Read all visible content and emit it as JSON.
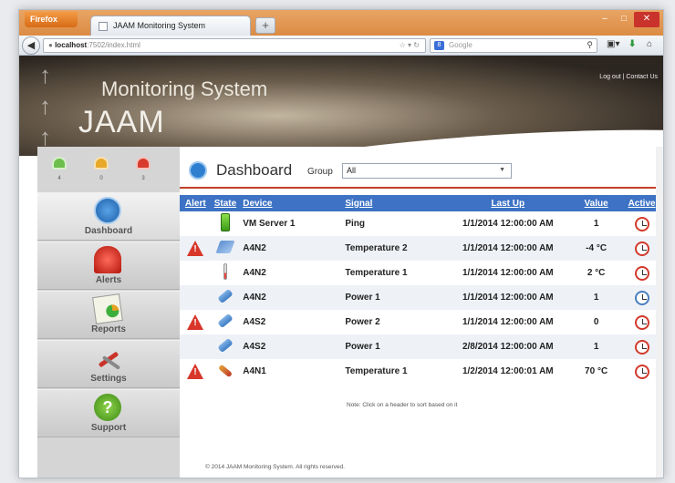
{
  "browser": {
    "menu_label": "Firefox",
    "tab_title": "JAAM Monitoring System",
    "newtab_label": "+",
    "url_host": "localhost",
    "url_path": ":7502/index.html",
    "search_placeholder": "Google",
    "search_engine_glyph": "8"
  },
  "header": {
    "title_top": "Monitoring System",
    "title_brand": "JAAM",
    "link_logout": "Log out",
    "link_separator": " | ",
    "link_contact": "Contact Us"
  },
  "gauges": [
    {
      "color": "#6dbf4b",
      "count": "4"
    },
    {
      "color": "#e8a92b",
      "count": "0"
    },
    {
      "color": "#d83a2b",
      "count": "3"
    }
  ],
  "sidebar": {
    "items": [
      {
        "label": "Dashboard",
        "icon": "gauge-icon"
      },
      {
        "label": "Alerts",
        "icon": "siren-icon"
      },
      {
        "label": "Reports",
        "icon": "report-icon"
      },
      {
        "label": "Settings",
        "icon": "wrench-icon"
      },
      {
        "label": "Support",
        "icon": "help-icon"
      }
    ]
  },
  "dashboard": {
    "title": "Dashboard",
    "group_label": "Group",
    "group_value": "All"
  },
  "table": {
    "headers": [
      "Alert",
      "State",
      "Device",
      "Signal",
      "Last Up",
      "Value",
      "Active"
    ],
    "rows": [
      {
        "alert": false,
        "state": "battery-icon",
        "device": "VM Server 1",
        "signal": "Ping",
        "last_up": "1/1/2014 12:00:00 AM",
        "value": "1",
        "active": "alarm-clock-red-icon"
      },
      {
        "alert": true,
        "state": "sensor-icon",
        "device": "A4N2",
        "signal": "Temperature 2",
        "last_up": "1/1/2014 12:00:00 AM",
        "value": "-4 °C",
        "active": "alarm-clock-red-icon"
      },
      {
        "alert": false,
        "state": "thermometer-icon",
        "device": "A4N2",
        "signal": "Temperature 1",
        "last_up": "1/1/2014 12:00:00 AM",
        "value": "2 °C",
        "active": "alarm-clock-red-icon"
      },
      {
        "alert": false,
        "state": "plug-icon",
        "device": "A4N2",
        "signal": "Power 1",
        "last_up": "1/1/2014 12:00:00 AM",
        "value": "1",
        "active": "alarm-clock-blue-icon"
      },
      {
        "alert": true,
        "state": "plug-icon",
        "device": "A4S2",
        "signal": "Power 2",
        "last_up": "1/1/2014 12:00:00 AM",
        "value": "0",
        "active": "alarm-clock-red-icon"
      },
      {
        "alert": false,
        "state": "plug-icon",
        "device": "A4S2",
        "signal": "Power 1",
        "last_up": "2/8/2014 12:00:00 AM",
        "value": "1",
        "active": "alarm-clock-red-icon"
      },
      {
        "alert": true,
        "state": "probe-icon",
        "device": "A4N1",
        "signal": "Temperature 1",
        "last_up": "1/2/2014 12:00:01 AM",
        "value": "70 °C",
        "active": "alarm-clock-red-icon"
      }
    ],
    "note": "Note: Click on a header to sort based on it"
  },
  "footer": "© 2014 JAAM Monitoring System. All rights reserved."
}
